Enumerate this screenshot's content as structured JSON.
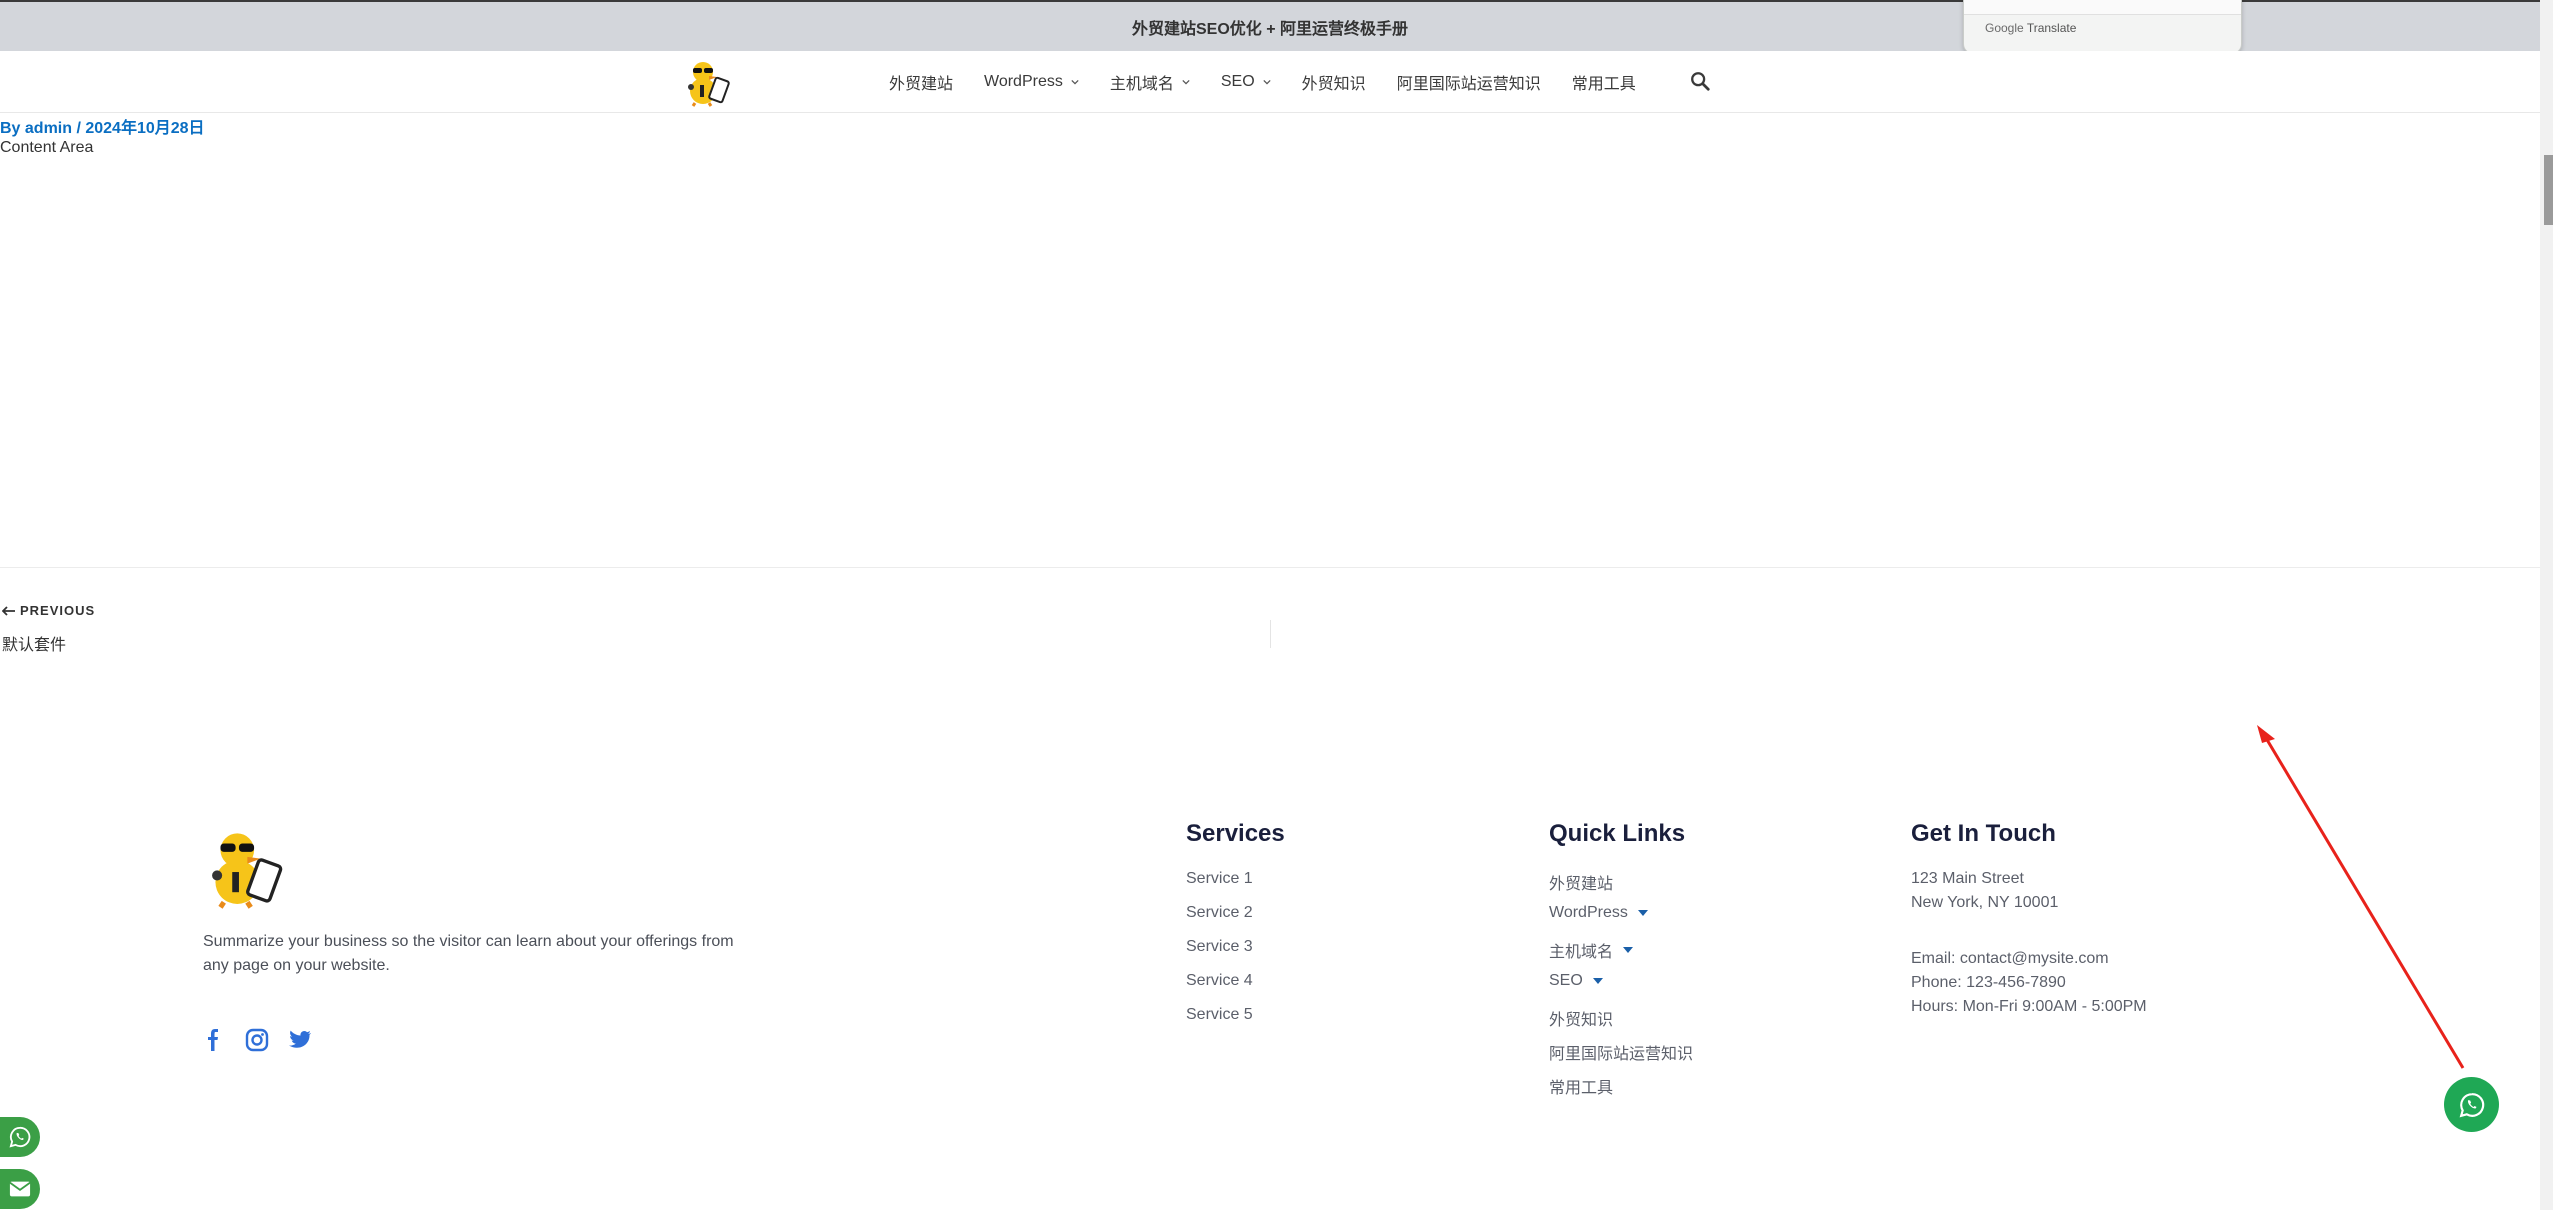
{
  "topbar": {
    "text": "外贸建站SEO优化 +  阿里运营终极手册"
  },
  "translate_popup": {
    "brand": "Google",
    "label": "Translate"
  },
  "nav": {
    "items": [
      {
        "label": "外贸建站",
        "dropdown": false
      },
      {
        "label": "WordPress",
        "dropdown": true
      },
      {
        "label": "主机域名",
        "dropdown": true
      },
      {
        "label": "SEO",
        "dropdown": true
      },
      {
        "label": "外贸知识",
        "dropdown": false
      },
      {
        "label": "阿里国际站运营知识",
        "dropdown": false
      },
      {
        "label": "常用工具",
        "dropdown": false
      }
    ],
    "search_icon": "search-icon"
  },
  "post": {
    "meta": "By admin / 2024年10月28日",
    "content": "Content Area"
  },
  "post_nav": {
    "previous_label": "PREVIOUS",
    "previous_title": "默认套件"
  },
  "footer": {
    "description": "Summarize your business so the visitor can learn about your offerings from any page on your website.",
    "social": [
      "facebook-icon",
      "instagram-icon",
      "twitter-icon"
    ],
    "services": {
      "title": "Services",
      "links": [
        "Service 1",
        "Service 2",
        "Service 3",
        "Service 4",
        "Service 5"
      ]
    },
    "quick_links": {
      "title": "Quick Links",
      "links": [
        {
          "label": "外贸建站",
          "dropdown": false
        },
        {
          "label": "WordPress",
          "dropdown": true
        },
        {
          "label": "主机域名",
          "dropdown": true
        },
        {
          "label": "SEO",
          "dropdown": true
        },
        {
          "label": "外贸知识",
          "dropdown": false
        },
        {
          "label": "阿里国际站运营知识",
          "dropdown": false
        },
        {
          "label": "常用工具",
          "dropdown": false
        }
      ]
    },
    "contact": {
      "title": "Get In Touch",
      "address1": "123 Main Street",
      "address2": "New York, NY 10001",
      "email": "Email: contact@mysite.com",
      "phone": "Phone: 123-456-7890",
      "hours": "Hours: Mon-Fri 9:00AM - 5:00PM"
    }
  },
  "colors": {
    "accent": "#0a6ec2",
    "whatsapp": "#1fa855",
    "side_button": "#3b9f46",
    "annotation": "#e8221b"
  }
}
